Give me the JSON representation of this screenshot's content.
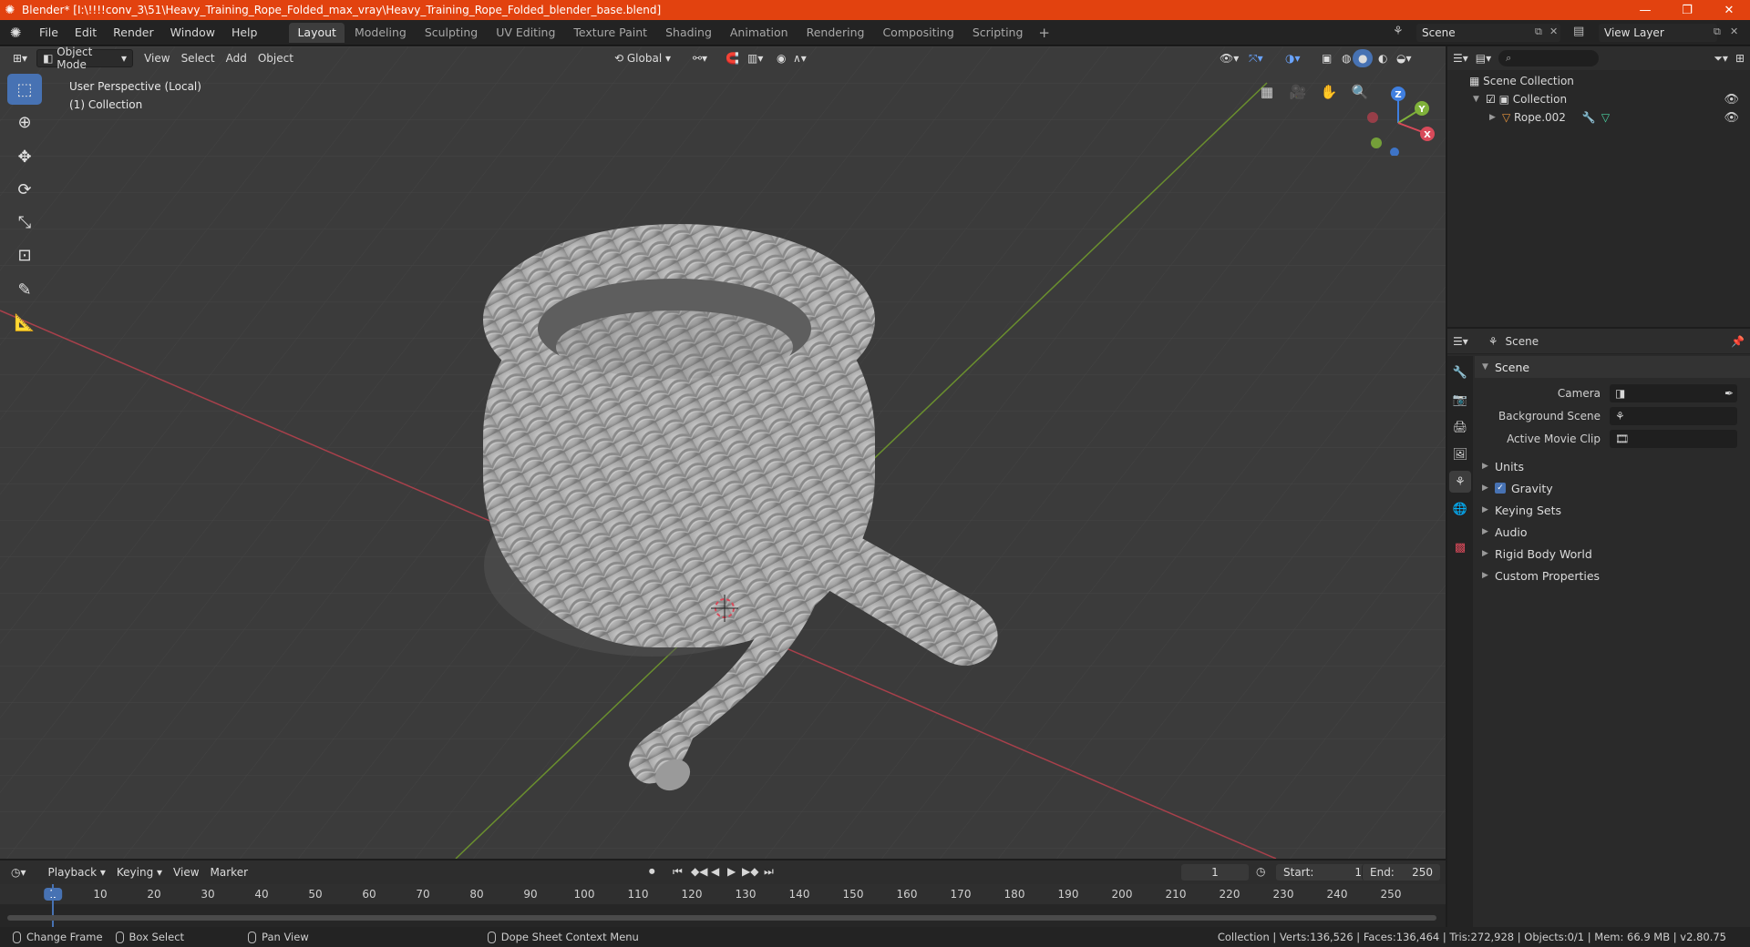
{
  "titlebar": {
    "title": "Blender* [I:\\!!!!conv_3\\51\\Heavy_Training_Rope_Folded_max_vray\\Heavy_Training_Rope_Folded_blender_base.blend]",
    "minimize": "—",
    "maximize": "❐",
    "close": "✕"
  },
  "menu": [
    "File",
    "Edit",
    "Render",
    "Window",
    "Help"
  ],
  "workspaces": [
    "Layout",
    "Modeling",
    "Sculpting",
    "UV Editing",
    "Texture Paint",
    "Shading",
    "Animation",
    "Rendering",
    "Compositing",
    "Scripting"
  ],
  "workspace_active": "Layout",
  "scene_name": "Scene",
  "view_layer": "View Layer",
  "viewport": {
    "mode": "Object Mode",
    "menus": [
      "View",
      "Select",
      "Add",
      "Object"
    ],
    "orientation": "Global",
    "info_line1": "User Perspective (Local)",
    "info_line2": "(1) Collection",
    "gizmo_axes": {
      "x": "X",
      "y": "Y",
      "z": "Z"
    }
  },
  "outliner": {
    "root": "Scene Collection",
    "collection": "Collection",
    "object": "Rope.002"
  },
  "properties": {
    "header_title": "Scene",
    "panel_title": "Scene",
    "camera_label": "Camera",
    "background_scene_label": "Background Scene",
    "active_movie_clip_label": "Active Movie Clip",
    "subpanels": {
      "units": "Units",
      "gravity": "Gravity",
      "keying_sets": "Keying Sets",
      "audio": "Audio",
      "rigid_body_world": "Rigid Body World",
      "custom_properties": "Custom Properties"
    }
  },
  "timeline": {
    "menus": [
      "Playback",
      "Keying",
      "View",
      "Marker"
    ],
    "current_frame": "1",
    "start_label": "Start:",
    "start_value": "1",
    "end_label": "End:",
    "end_value": "250",
    "ticks": [
      "1",
      "10",
      "20",
      "30",
      "40",
      "50",
      "60",
      "70",
      "80",
      "90",
      "100",
      "110",
      "120",
      "130",
      "140",
      "150",
      "160",
      "170",
      "180",
      "190",
      "200",
      "210",
      "220",
      "230",
      "240",
      "250"
    ]
  },
  "statusbar": {
    "change_frame": "Change Frame",
    "box_select": "Box Select",
    "pan_view": "Pan View",
    "context_menu": "Dope Sheet Context Menu",
    "stats": "Collection | Verts:136,526 | Faces:136,464 | Tris:272,928 | Objects:0/1 | Mem: 66.9 MB | v2.80.75"
  },
  "colors": {
    "accent": "#4772b3",
    "titlebar": "#e2420f",
    "x_axis": "#d84a5a",
    "y_axis": "#7fb13a",
    "z_axis": "#3f7fe0"
  }
}
